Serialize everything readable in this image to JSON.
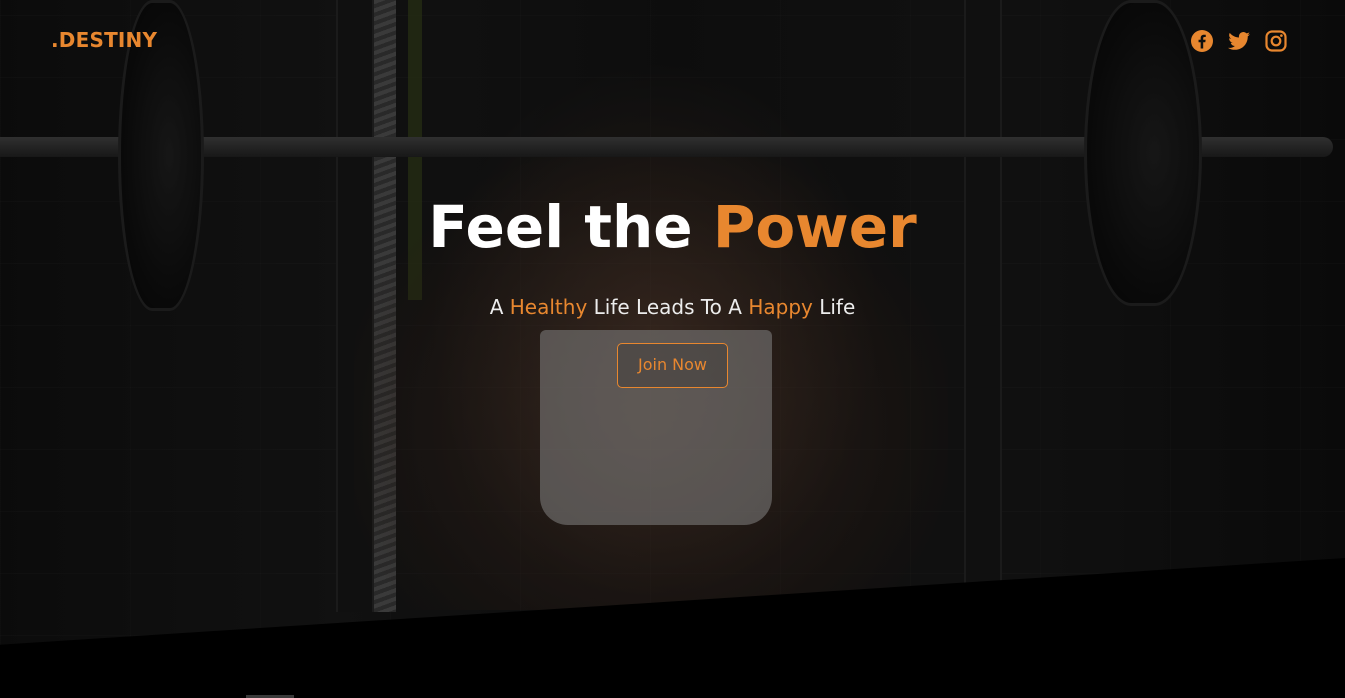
{
  "brand": {
    "logo": ".DESTINY",
    "accent_color": "#e8872f"
  },
  "social": [
    {
      "name": "facebook",
      "icon": "facebook-icon"
    },
    {
      "name": "twitter",
      "icon": "twitter-icon"
    },
    {
      "name": "instagram",
      "icon": "instagram-icon"
    }
  ],
  "hero": {
    "headline_part1": "Feel the ",
    "headline_accent": "Power",
    "tagline_part1": "A ",
    "tagline_accent1": "Healthy",
    "tagline_part2": " Life Leads To A ",
    "tagline_accent2": "Happy",
    "tagline_part3": " Life",
    "cta_label": "Join Now"
  }
}
